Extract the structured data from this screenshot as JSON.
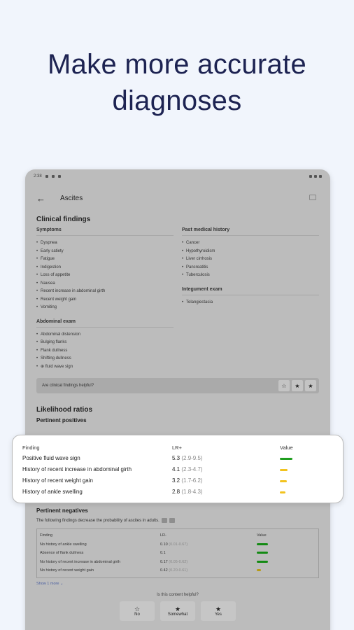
{
  "headline": "Make more accurate diagnoses",
  "status": {
    "time": "2:38"
  },
  "appbar": {
    "title": "Ascites"
  },
  "clinical": {
    "heading": "Clinical findings",
    "symptoms": {
      "title": "Symptoms",
      "items": [
        "Dyspnea",
        "Early satiety",
        "Fatigue",
        "Indigestion",
        "Loss of appetite",
        "Nausea",
        "Recent increase in abdominal girth",
        "Recent weight gain",
        "Vomiting"
      ]
    },
    "abdominal": {
      "title": "Abdominal exam",
      "items": [
        "Abdominal distension",
        "Bulging flanks",
        "Flank dullness",
        "Shifting dullness",
        "⊕ fluid wave sign"
      ]
    },
    "pmh": {
      "title": "Past medical history",
      "items": [
        "Cancer",
        "Hypothyroidism",
        "Liver cirrhosis",
        "Pancreatitis",
        "Tuberculosis"
      ]
    },
    "integ": {
      "title": "Integument exam",
      "items": [
        "Telangiectasia"
      ]
    },
    "helpful_question": "Are clinical findings helpful?"
  },
  "likelihood": {
    "heading": "Likelihood ratios",
    "positives_heading": "Pertinent positives",
    "columns": {
      "finding": "Finding",
      "lr": "LR+",
      "value": "Value"
    },
    "rows": [
      {
        "finding": "Positive fluid wave sign",
        "lr": "5.3",
        "ci": "(2.9-9.5)",
        "bar_fraction": 0.9,
        "color": "#1f9e1f"
      },
      {
        "finding": "History of recent increase in abdominal girth",
        "lr": "4.1",
        "ci": "(2.3-4.7)",
        "bar_fraction": 0.55,
        "color": "#f2c31f"
      },
      {
        "finding": "History of recent weight gain",
        "lr": "3.2",
        "ci": "(1.7-6.2)",
        "bar_fraction": 0.5,
        "color": "#f2c31f"
      },
      {
        "finding": "History of ankle swelling",
        "lr": "2.8",
        "ci": "(1.8-4.3)",
        "bar_fraction": 0.4,
        "color": "#f2c31f"
      }
    ]
  },
  "negatives": {
    "heading": "Pertinent negatives",
    "description": "The following findings decrease the probability of ascites in adults.",
    "columns": {
      "finding": "Finding",
      "lr": "LR-",
      "value": "Value"
    },
    "rows": [
      {
        "finding": "No history of ankle swelling",
        "lr": "0.10",
        "ci": "(0.01-0.67)",
        "level": "green"
      },
      {
        "finding": "Absence of flank dullness",
        "lr": "0.1",
        "ci": "",
        "level": "green"
      },
      {
        "finding": "No history of recent increase in abdominal girth",
        "lr": "0.17",
        "ci": "(0.05-0.62)",
        "level": "green"
      },
      {
        "finding": "No history of recent weight gain",
        "lr": "0.42",
        "ci": "(0.20-0.61)",
        "level": "yellow"
      }
    ],
    "show_more": "Show 1 more ⌄"
  },
  "feedback": {
    "question": "Is this content helpful?",
    "buttons": [
      "No",
      "Somewhat",
      "Yes"
    ]
  }
}
